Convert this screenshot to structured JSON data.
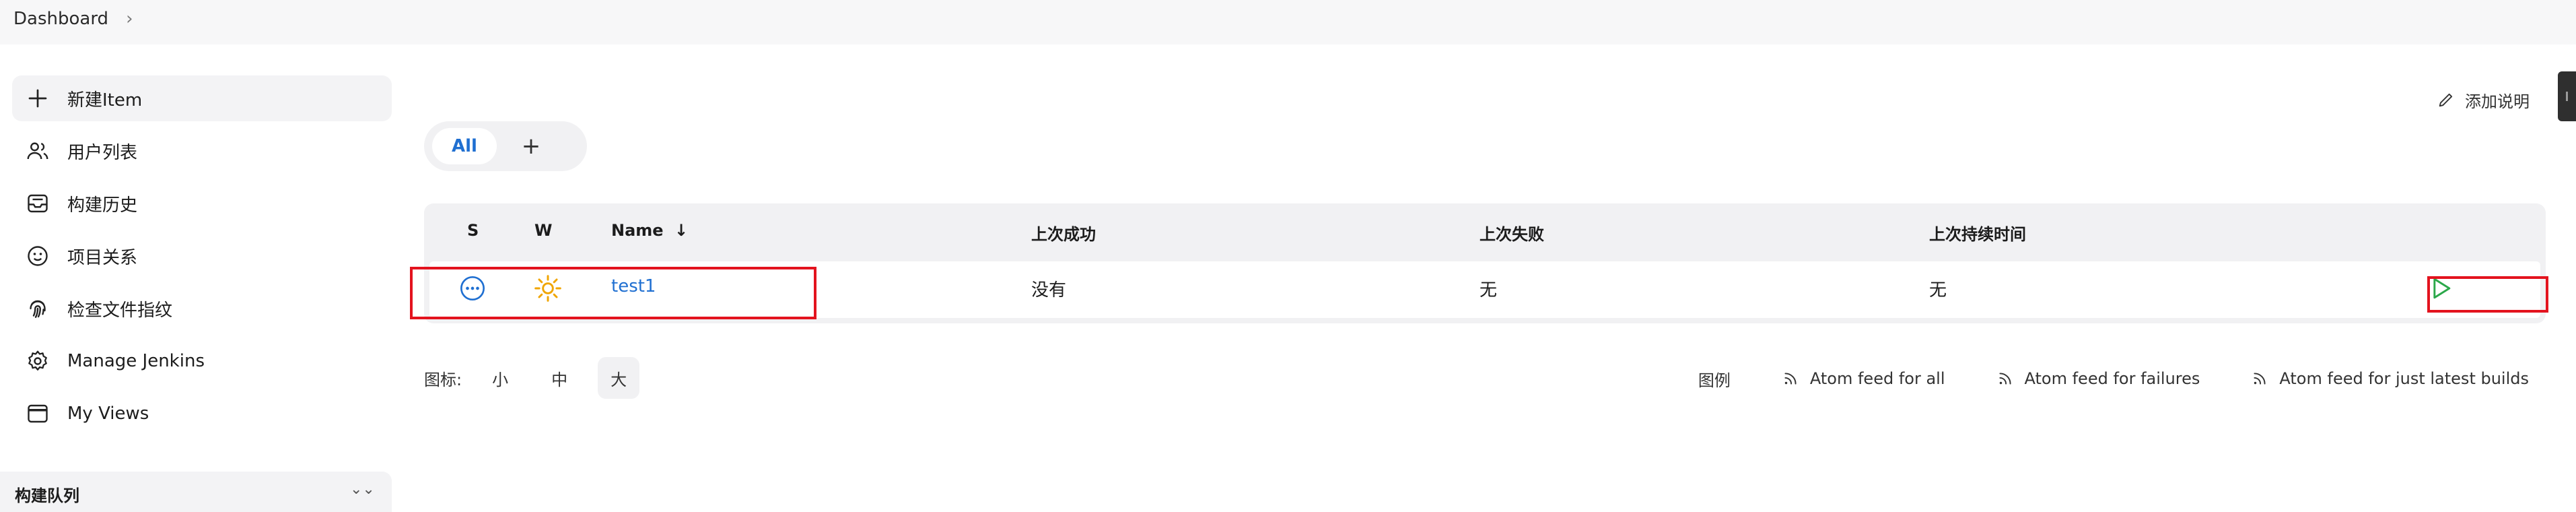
{
  "breadcrumb": {
    "root": "Dashboard",
    "separator_icon": "chevron-right-icon"
  },
  "sidebar": {
    "items": [
      {
        "label": "新建Item",
        "icon": "plus-icon"
      },
      {
        "label": "用户列表",
        "icon": "users-icon"
      },
      {
        "label": "构建历史",
        "icon": "inbox-icon"
      },
      {
        "label": "项目关系",
        "icon": "relationship-icon"
      },
      {
        "label": "检查文件指纹",
        "icon": "fingerprint-icon"
      },
      {
        "label": "Manage Jenkins",
        "icon": "gear-icon"
      },
      {
        "label": "My Views",
        "icon": "window-icon"
      }
    ],
    "queue_title": "构建队列"
  },
  "description_link": {
    "label": "添加说明",
    "icon": "pencil-icon"
  },
  "tabs": {
    "all_label": "All",
    "add_label": "+"
  },
  "table": {
    "headers": {
      "s": "S",
      "w": "W",
      "name": "Name",
      "sort": "↓",
      "last_success": "上次成功",
      "last_failure": "上次失败",
      "last_duration": "上次持续时间"
    },
    "rows": [
      {
        "name": "test1",
        "last_success": "没有",
        "last_failure": "无",
        "last_duration": "无",
        "status_icon": "not-built-icon",
        "weather_icon": "sun-icon",
        "action_icon": "play-icon"
      }
    ]
  },
  "icon_size": {
    "label": "图标:",
    "options": [
      "小",
      "中",
      "大"
    ],
    "selected": "大"
  },
  "footer": {
    "legend": "图例",
    "feeds": [
      "Atom feed for all",
      "Atom feed for failures",
      "Atom feed for just latest builds"
    ],
    "feed_icon": "rss-icon"
  },
  "colors": {
    "link": "#1f6fd1",
    "highlight": "#e3131e",
    "play": "#2ba84a",
    "weather": "#f0a500"
  }
}
